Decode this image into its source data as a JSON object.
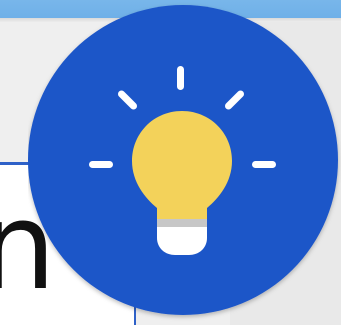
{
  "screen": {
    "title": "",
    "background_color": "#ececec",
    "accent_color": "#2e61c8",
    "logo_color": "#1f56c8",
    "bulb_color": "#f3d25a",
    "text_color": "#111111"
  },
  "content": {
    "partial_text": "n"
  },
  "logo": {
    "icon_name": "lightbulb-icon"
  }
}
